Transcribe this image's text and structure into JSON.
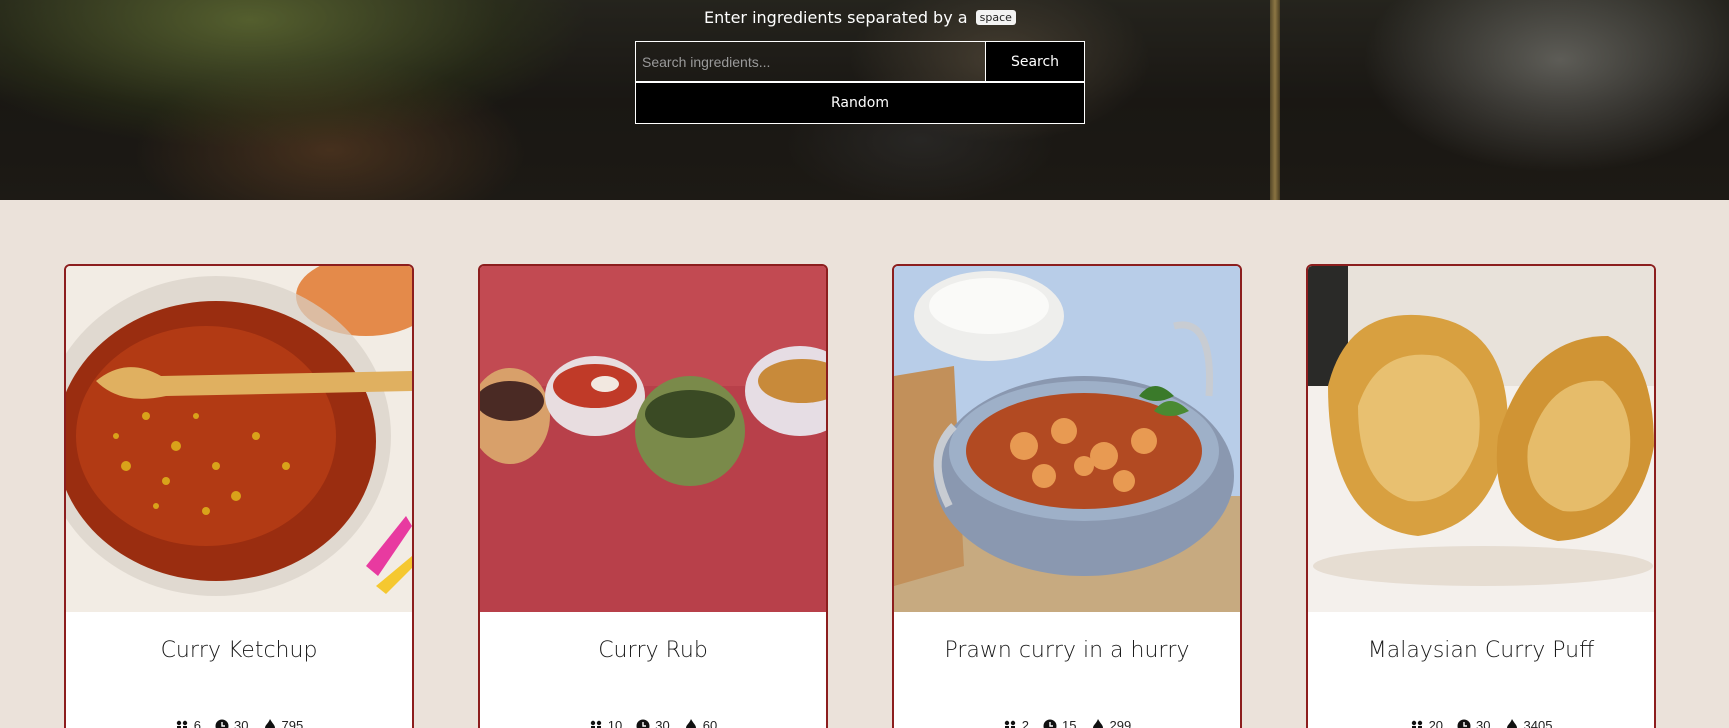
{
  "hero": {
    "hint_text": "Enter ingredients separated by a",
    "hint_key": "space",
    "search_placeholder": "Search ingredients...",
    "search_value": "",
    "search_button": "Search",
    "random_button": "Random"
  },
  "recipes": [
    {
      "title": "Curry Ketchup",
      "servings": "6",
      "time": "30",
      "calories": "795"
    },
    {
      "title": "Curry Rub",
      "servings": "10",
      "time": "30",
      "calories": "60"
    },
    {
      "title": "Prawn curry in a hurry",
      "servings": "2",
      "time": "15",
      "calories": "299"
    },
    {
      "title": "Malaysian Curry Puff",
      "servings": "20",
      "time": "30",
      "calories": "3405"
    }
  ],
  "colors": {
    "background": "#ebe2da",
    "card_border": "#8c1e1e",
    "button": "#000000"
  },
  "icons": [
    "people-icon",
    "clock-icon",
    "flame-icon"
  ]
}
